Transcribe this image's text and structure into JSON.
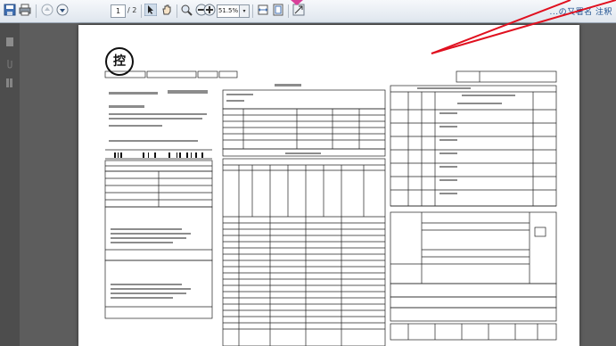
{
  "toolbar": {
    "page_current": "1",
    "page_total": "/ 2",
    "zoom_value": "51.5%",
    "right_links": "...の又署名  注釈"
  },
  "document": {
    "stamp_text": "控"
  },
  "colors": {
    "annotation_arrow": "#e0101f",
    "toolbar_bg": "#e8edf3",
    "viewer_bg": "#5d5d5d"
  }
}
